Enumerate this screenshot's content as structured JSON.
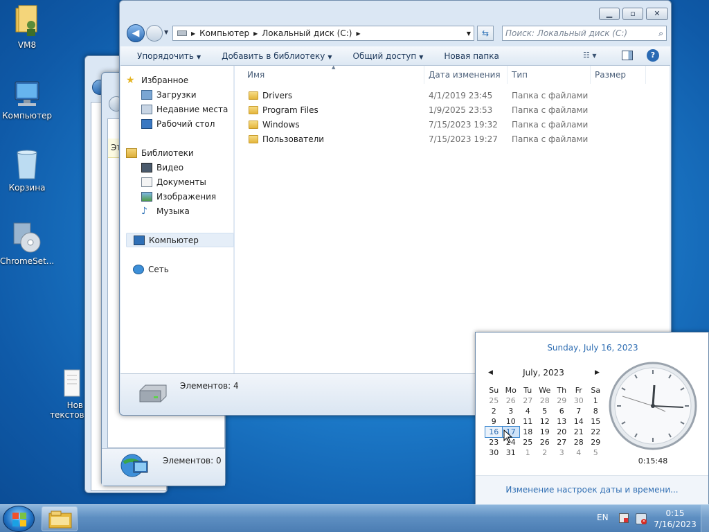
{
  "desktop": {
    "icons": [
      {
        "label": "VM8"
      },
      {
        "label": "Компьютер"
      },
      {
        "label": "Корзина"
      },
      {
        "label": "ChromeSet..."
      },
      {
        "label": "Нов текстов"
      }
    ]
  },
  "back_windows": {
    "window2": {
      "status": "Элементов: 0",
      "fragment": "Эт"
    }
  },
  "explorer": {
    "breadcrumb": [
      "Компьютер",
      "Локальный диск (C:)"
    ],
    "search_placeholder": "Поиск: Локальный диск (C:)",
    "toolbar": {
      "organize": "Упорядочить",
      "add_library": "Добавить в библиотеку",
      "share": "Общий доступ",
      "new_folder": "Новая папка"
    },
    "nav": {
      "favorites": "Избранное",
      "downloads": "Загрузки",
      "recent": "Недавние места",
      "desktop": "Рабочий стол",
      "libraries": "Библиотеки",
      "video": "Видео",
      "documents": "Документы",
      "images": "Изображения",
      "music": "Музыка",
      "computer": "Компьютер",
      "network": "Сеть"
    },
    "columns": {
      "name": "Имя",
      "date": "Дата изменения",
      "type": "Тип",
      "size": "Размер"
    },
    "files": [
      {
        "name": "Drivers",
        "date": "4/1/2019 23:45",
        "type": "Папка с файлами"
      },
      {
        "name": "Program Files",
        "date": "1/9/2025 23:53",
        "type": "Папка с файлами"
      },
      {
        "name": "Windows",
        "date": "7/15/2023 19:32",
        "type": "Папка с файлами"
      },
      {
        "name": "Пользователи",
        "date": "7/15/2023 19:27",
        "type": "Папка с файлами"
      }
    ],
    "status": "Элементов: 4"
  },
  "clock_popup": {
    "long_date": "Sunday, July 16, 2023",
    "month_label": "July, 2023",
    "weekdays": [
      "Su",
      "Mo",
      "Tu",
      "We",
      "Th",
      "Fr",
      "Sa"
    ],
    "weeks": [
      [
        "25",
        "26",
        "27",
        "28",
        "29",
        "30",
        "1"
      ],
      [
        "2",
        "3",
        "4",
        "5",
        "6",
        "7",
        "8"
      ],
      [
        "9",
        "10",
        "11",
        "12",
        "13",
        "14",
        "15"
      ],
      [
        "16",
        "17",
        "18",
        "19",
        "20",
        "21",
        "22"
      ],
      [
        "23",
        "24",
        "25",
        "26",
        "27",
        "28",
        "29"
      ],
      [
        "30",
        "31",
        "1",
        "2",
        "3",
        "4",
        "5"
      ]
    ],
    "selected_day": "16",
    "hover_day": "17",
    "time": "0:15:48",
    "settings_link": "Изменение настроек даты и времени..."
  },
  "taskbar": {
    "language": "EN",
    "time": "0:15",
    "date": "7/16/2023"
  }
}
